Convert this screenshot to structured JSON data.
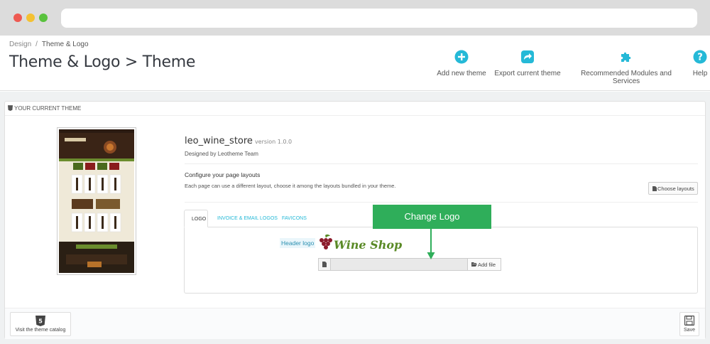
{
  "breadcrumb": {
    "parent": "Design",
    "separator": "/",
    "current": "Theme & Logo"
  },
  "page_title": "Theme & Logo > Theme",
  "toolbar": {
    "add_new_theme": "Add new theme",
    "export_current_theme": "Export current theme",
    "recommended_modules": "Recommended Modules and Services",
    "help": "Help"
  },
  "panel": {
    "heading": "YOUR CURRENT THEME",
    "theme_name": "leo_wine_store",
    "theme_version": "version 1.0.0",
    "designer": "Designed by Leotheme Team",
    "layouts_title": "Configure your page layouts",
    "layouts_desc": "Each page can use a different layout, choose it among the layouts bundled in your theme.",
    "choose_layouts": "Choose layouts"
  },
  "tabs": [
    {
      "label": "LOGO",
      "active": true
    },
    {
      "label": "INVOICE & EMAIL LOGOS",
      "active": false
    },
    {
      "label": "FAVICONS",
      "active": false
    }
  ],
  "logo_section": {
    "header_logo_label": "Header logo",
    "logo_text": "Wine Shop",
    "add_file": "Add file",
    "file_value": ""
  },
  "footer": {
    "visit_catalog": "Visit the theme catalog",
    "save": "Save"
  },
  "callout": {
    "text": "Change Logo"
  },
  "colors": {
    "accent": "#25b9d7",
    "callout": "#2fae5a",
    "logo_green": "#5a8a26",
    "grape": "#8b1a2b"
  }
}
